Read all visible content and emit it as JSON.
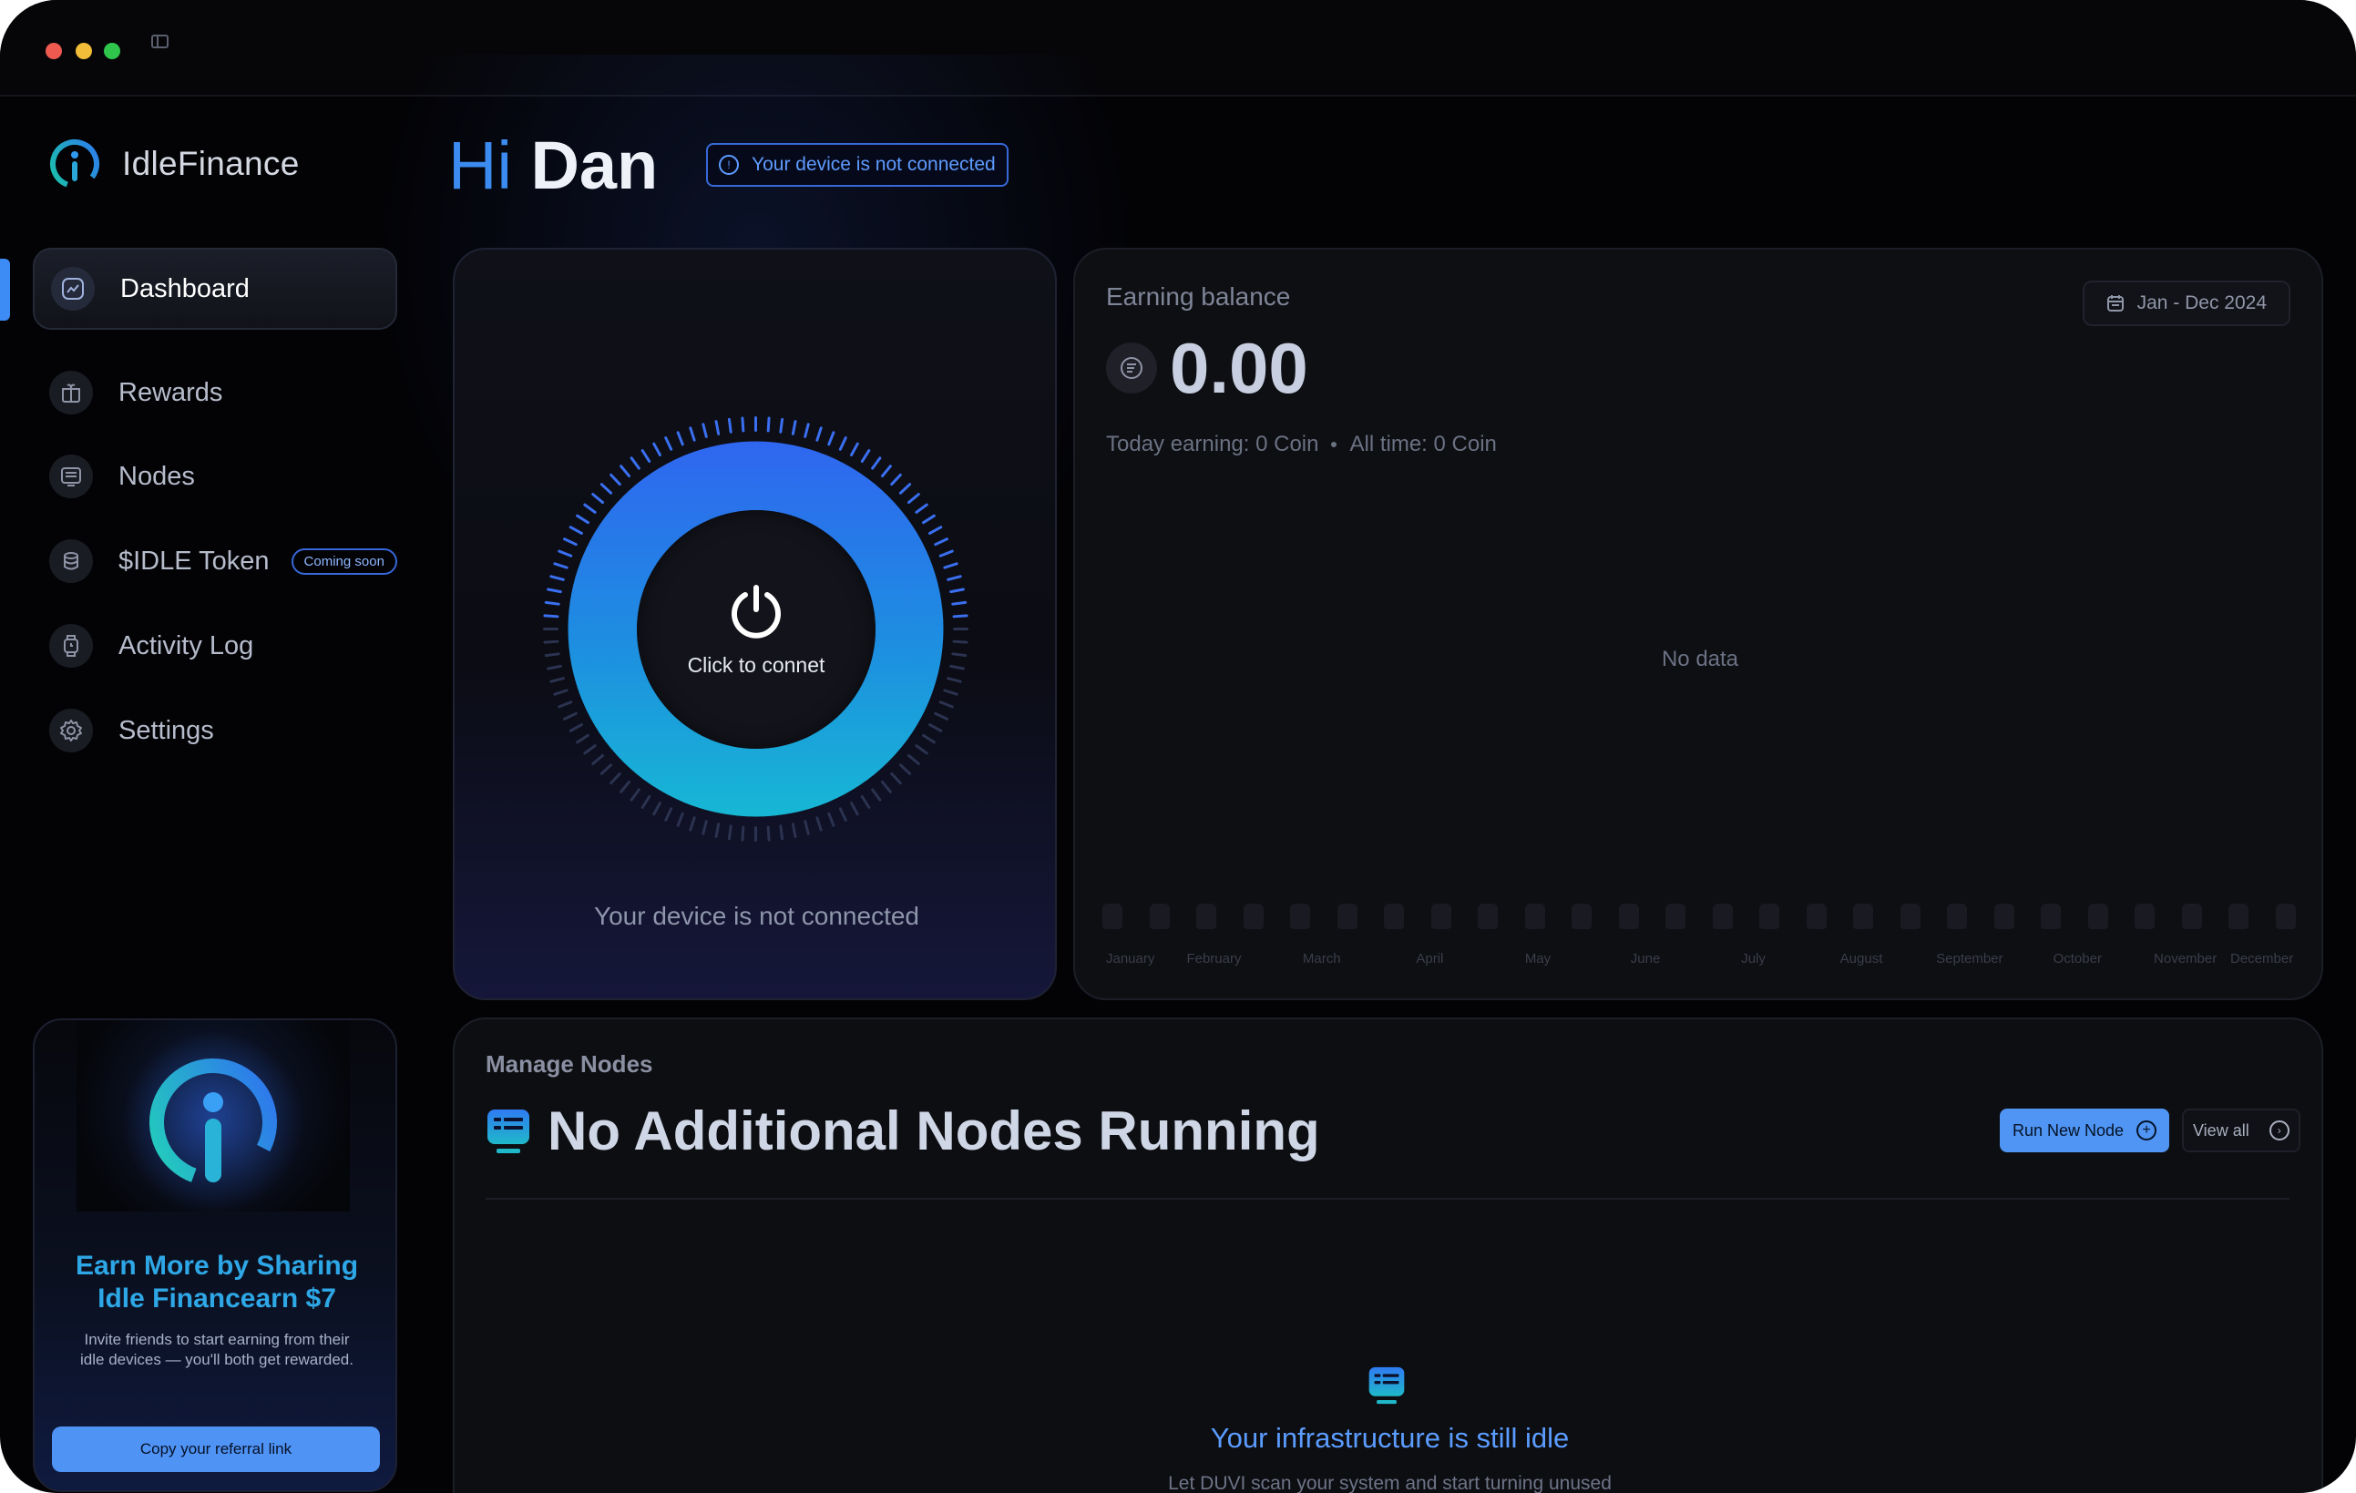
{
  "app": {
    "name": "IdleFinance"
  },
  "sidebar": {
    "items": [
      {
        "label": "Dashboard",
        "icon": "chart-icon",
        "active": true
      },
      {
        "label": "Rewards",
        "icon": "gift-icon"
      },
      {
        "label": "Nodes",
        "icon": "node-icon"
      },
      {
        "label": "$IDLE Token",
        "icon": "coins-icon",
        "badge": "Coming soon"
      },
      {
        "label": "Activity Log",
        "icon": "watch-icon"
      },
      {
        "label": "Settings",
        "icon": "gear-icon"
      }
    ]
  },
  "referral": {
    "title_line1": "Earn More by Sharing",
    "title_line2": "Idle Financearn $7",
    "description": "Invite friends to start earning from their idle devices — you'll both get rewarded.",
    "button": "Copy your referral link"
  },
  "header": {
    "hi": "Hi",
    "name": "Dan",
    "status_badge": "Your device is not connected"
  },
  "power": {
    "button_label": "Click to connet",
    "status": "Your device is not connected"
  },
  "earning": {
    "title": "Earning balance",
    "date_range": "Jan - Dec 2024",
    "balance": "0.00",
    "today": "Today earning: 0 Coin",
    "all_time": "All time: 0 Coin",
    "empty": "No data",
    "months": [
      "January",
      "February",
      "March",
      "April",
      "May",
      "June",
      "July",
      "August",
      "September",
      "October",
      "November",
      "December"
    ]
  },
  "nodes": {
    "subtitle": "Manage Nodes",
    "title": "No Additional Nodes Running",
    "run_button": "Run New Node",
    "view_all": "View all",
    "idle_title": "Your infrastructure is still idle",
    "idle_desc": "Let DUVI scan your system and start turning unused"
  },
  "colors": {
    "accent": "#3b8bf0",
    "ring_top": "#2f6bf0",
    "ring_bottom": "#18b5d6",
    "background": "#030306"
  }
}
